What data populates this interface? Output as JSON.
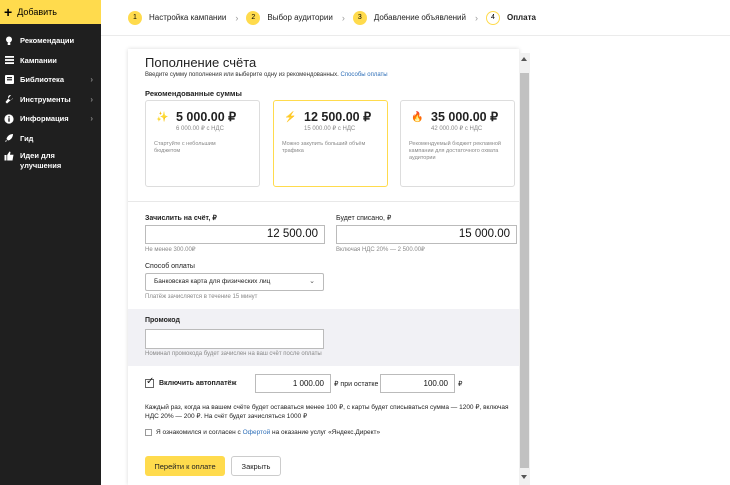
{
  "sidebar": {
    "add_label": "Добавить",
    "items": [
      {
        "label": "Рекомендации",
        "icon": "lightbulb-icon",
        "chevron": false
      },
      {
        "label": "Кампании",
        "icon": "list-icon",
        "chevron": false
      },
      {
        "label": "Библиотека",
        "icon": "library-icon",
        "chevron": true
      },
      {
        "label": "Инструменты",
        "icon": "wrench-icon",
        "chevron": true
      },
      {
        "label": "Информация",
        "icon": "info-icon",
        "chevron": true
      },
      {
        "label": "Гид",
        "icon": "rocket-icon",
        "chevron": false
      },
      {
        "label": "Идеи для улучшения",
        "icon": "thumbs-up-icon",
        "chevron": false
      }
    ]
  },
  "stepper": {
    "steps": [
      {
        "num": "1",
        "label": "Настройка кампании"
      },
      {
        "num": "2",
        "label": "Выбор аудитории"
      },
      {
        "num": "3",
        "label": "Добавление объявлений"
      },
      {
        "num": "4",
        "label": "Оплата"
      }
    ]
  },
  "panel": {
    "title": "Пополнение счёта",
    "subtitle": "Введите сумму пополнения или выберите одну из рекомендованных.",
    "subtitle_link": "Способы оплаты",
    "recommended_title": "Рекомендованные суммы",
    "cards": [
      {
        "amount": "5 000.00 ₽",
        "vat": "6 000.00 ₽ с НДС",
        "desc": "Стартуйте с небольшим бюджетом",
        "icon": "sparkle-icon",
        "selected": false
      },
      {
        "amount": "12 500.00 ₽",
        "vat": "15 000.00 ₽ с НДС",
        "desc": "Можно закупить больший объём трафика",
        "icon": "lightning-icon",
        "selected": true
      },
      {
        "amount": "35 000.00 ₽",
        "vat": "42 000.00 ₽ с НДС",
        "desc": "Рекомендуемый бюджет рекламной кампании для достаточного охвата аудитории",
        "icon": "fire-icon",
        "selected": false
      }
    ],
    "credit_label": "Зачислить на счёт, ₽",
    "credit_value": "12 500.00",
    "credit_hint": "Не менее 300.00₽",
    "charge_label": "Будет списано, ₽",
    "charge_value": "15 000.00",
    "charge_hint": "Включая НДС 20% — 2 500.00₽",
    "payment_label": "Способ оплаты",
    "payment_selected": "Банковская карта для физических лиц",
    "payment_hint": "Платёж зачисляется в течение 15 минут",
    "promo_label": "Промокод",
    "promo_value": "",
    "promo_hint": "Номинал промокода будет зачислен на ваш счёт после оплаты",
    "autopay_label": "Включить автоплатёж",
    "autopay_amount": "1 000.00",
    "autopay_mid": "₽ при остатке",
    "autopay_threshold": "100.00",
    "autopay_unit": "₽",
    "autopay_desc": "Каждый раз, когда на вашем счёте будет оставаться менее 100 ₽, с карты будет списываться сумма — 1200 ₽, включая НДС 20% — 200 ₽. На счёт будет зачисляться 1000 ₽",
    "offer_prefix": "Я ознакомился и согласен с",
    "offer_link": "Офертой",
    "offer_suffix": "на оказание услуг «Яндекс.Директ»",
    "pay_button": "Перейти к оплате",
    "close_button": "Закрыть"
  },
  "colors": {
    "accent": "#ffdb4d",
    "sidebar": "#1f1f1f",
    "link": "#2e6fb8"
  }
}
